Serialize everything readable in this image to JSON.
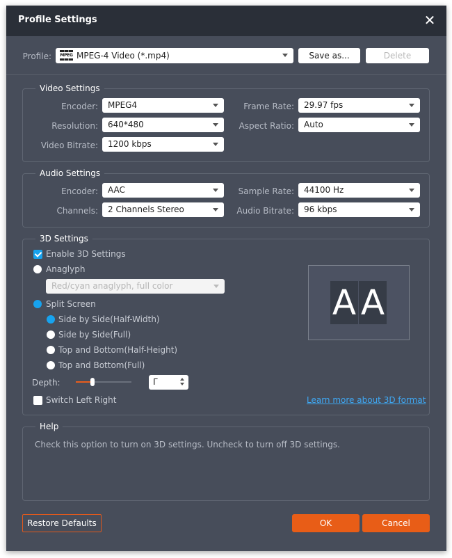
{
  "window": {
    "title": "Profile Settings",
    "close_icon": "close-icon"
  },
  "profile": {
    "label": "Profile:",
    "value": "MPEG-4 Video (*.mp4)",
    "icon": "mpeg-icon",
    "icon_text": "MPEG",
    "save_as": "Save as...",
    "delete": "Delete"
  },
  "video": {
    "title": "Video Settings",
    "encoder_label": "Encoder:",
    "encoder": "MPEG4",
    "resolution_label": "Resolution:",
    "resolution": "640*480",
    "bitrate_label": "Video Bitrate:",
    "bitrate": "1200 kbps",
    "framerate_label": "Frame Rate:",
    "framerate": "29.97 fps",
    "aspect_label": "Aspect Ratio:",
    "aspect": "Auto"
  },
  "audio": {
    "title": "Audio Settings",
    "encoder_label": "Encoder:",
    "encoder": "AAC",
    "channels_label": "Channels:",
    "channels": "2 Channels Stereo",
    "samplerate_label": "Sample Rate:",
    "samplerate": "44100 Hz",
    "bitrate_label": "Audio Bitrate:",
    "bitrate": "96 kbps"
  },
  "threed": {
    "title": "3D Settings",
    "enable_label": "Enable 3D Settings",
    "enable_checked": true,
    "anaglyph_label": "Anaglyph",
    "anaglyph_option": "Red/cyan anaglyph, full color",
    "split_label": "Split Screen",
    "split_options": [
      {
        "label": "Side by Side(Half-Width)",
        "selected": true
      },
      {
        "label": "Side by Side(Full)",
        "selected": false
      },
      {
        "label": "Top and Bottom(Half-Height)",
        "selected": false
      },
      {
        "label": "Top and Bottom(Full)",
        "selected": false
      }
    ],
    "depth_label": "Depth:",
    "depth_slider_fraction": 0.3,
    "depth_value": "Γ",
    "switch_label": "Switch Left Right",
    "switch_checked": false,
    "preview_text": "A",
    "learn_more": "Learn more about 3D format"
  },
  "help": {
    "title": "Help",
    "text": "Check this option to turn on 3D settings. Uncheck to turn off 3D settings."
  },
  "footer": {
    "restore": "Restore Defaults",
    "ok": "OK",
    "cancel": "Cancel"
  },
  "colors": {
    "accent_orange": "#e85d17",
    "accent_blue": "#17a3ef",
    "link_blue": "#3fa9f5",
    "titlebar": "#2a2f38",
    "panel": "#474d5a"
  }
}
